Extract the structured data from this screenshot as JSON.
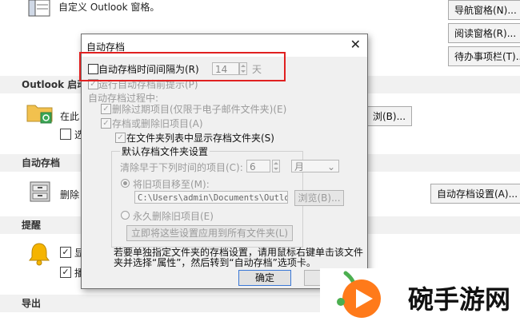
{
  "background": {
    "top_text": "自定义 Outlook 窗格。",
    "buttons": {
      "nav_pane": "导航窗格(N)...",
      "reading_pane": "阅读窗格(R)...",
      "todo_bar": "待办事项栏(T)...",
      "browse_b": "浏(B)...",
      "autoarchive_settings": "自动存档设置(A)..."
    },
    "section_outlook_start": "Outlook 启动",
    "outlook_start_text_1": "在此",
    "outlook_start_text_2": "选",
    "section_autoarchive": "自动存档",
    "autoarchive_text": "删除",
    "section_reminders": "提醒",
    "reminder_text_1": "显",
    "reminder_text_2": "播",
    "section_export": "导出"
  },
  "dialog": {
    "title": "自动存档",
    "close": "✕",
    "run_every_label": "自动存档时间间隔为(R)",
    "interval_value": "14",
    "interval_unit": "天",
    "prompt_label": "运行自动存档前提示(P)",
    "during_label": "自动存档过程中:",
    "delete_expired_label": "删除过期项目(仅限于电子邮件文件夹)(E)",
    "archive_or_delete_label": "存档或删除旧项目(A)",
    "show_archive_label": "在文件夹列表中显示存档文件夹(S)",
    "default_settings_title": "默认存档文件夹设置",
    "clean_older_label": "清除早于下列时间的项目(C):",
    "clean_value": "6",
    "clean_unit": "月",
    "move_to_label": "将旧项目移至(M):",
    "path_value": "C:\\Users\\admin\\Documents\\Outloo",
    "browse_label": "浏览(B)...",
    "permanent_delete_label": "永久删除旧项目(E)",
    "apply_all_label": "立即将这些设置应用到所有文件夹(L)",
    "note": "若要单独指定文件夹的存档设置，请用鼠标右键单击该文件夹并选择“属性”，然后转到“自动存档”选项卡。",
    "ok_label": "确定"
  },
  "watermark": {
    "text": "碗手游网"
  },
  "colors": {
    "highlight": "#e02020",
    "accent": "#3a78d6",
    "wm_green": "#4caf50",
    "wm_orange": "#ff7a1a"
  }
}
